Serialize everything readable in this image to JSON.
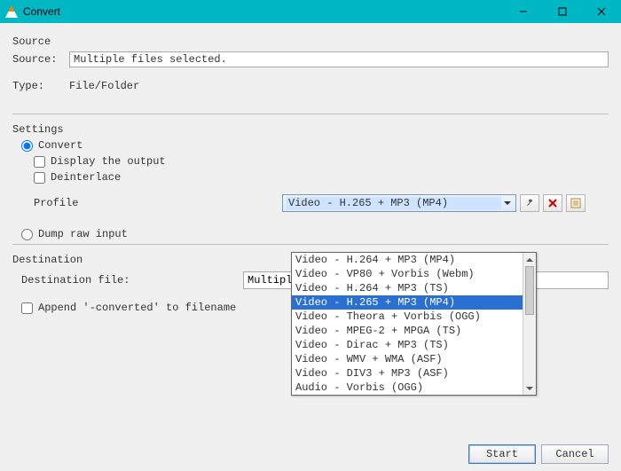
{
  "window": {
    "title": "Convert"
  },
  "source_section": {
    "title": "Source",
    "source_label": "Source:",
    "source_value": "Multiple files selected.",
    "type_label": "Type:",
    "type_value": "File/Folder"
  },
  "settings_section": {
    "title": "Settings",
    "convert_option": "Convert",
    "display_output": "Display the output",
    "deinterlace": "Deinterlace",
    "profile_label": "Profile",
    "profile_selected": "Video - H.265 + MP3 (MP4)",
    "dump_option": "Dump raw input"
  },
  "profile_options": [
    "Video - H.264 + MP3 (MP4)",
    "Video - VP80 + Vorbis (Webm)",
    "Video - H.264 + MP3 (TS)",
    "Video - H.265 + MP3 (MP4)",
    "Video - Theora + Vorbis (OGG)",
    "Video - MPEG-2 + MPGA (TS)",
    "Video - Dirac + MP3 (TS)",
    "Video - WMV + WMA (ASF)",
    "Video - DIV3 + MP3 (ASF)",
    "Audio - Vorbis (OGG)"
  ],
  "profile_selected_index": 3,
  "destination_section": {
    "title": "Destination",
    "dest_label": "Destination file:",
    "dest_value": "Multiple Fil",
    "append_label": "Append '-converted' to filename"
  },
  "buttons": {
    "start": "Start",
    "cancel": "Cancel"
  },
  "icons": {
    "tools": "tools-icon",
    "delete": "delete-icon",
    "new": "new-profile-icon"
  }
}
